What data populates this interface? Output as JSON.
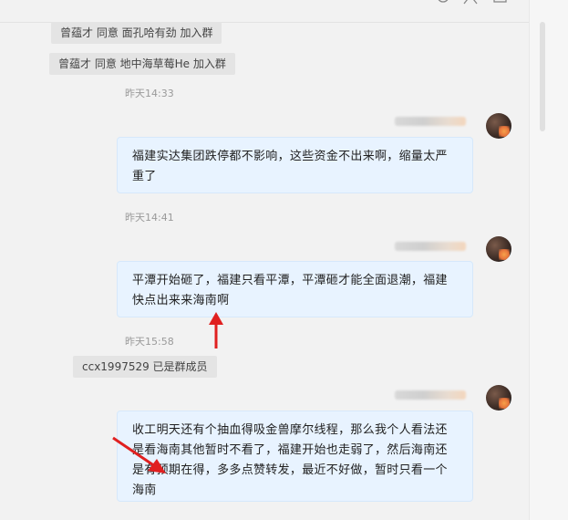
{
  "messages": [
    {
      "type": "system",
      "text": "曾蕴才 同意 面孔哈有劲 加入群"
    },
    {
      "type": "system",
      "text": "曾蕴才 同意 地中海草莓He 加入群"
    },
    {
      "type": "time",
      "text": "昨天14:33"
    },
    {
      "type": "chat",
      "text": "福建实达集团跌停都不影响，这些资金不出来啊，缩量太严重了"
    },
    {
      "type": "time",
      "text": "昨天14:41"
    },
    {
      "type": "chat",
      "text": "平潭开始砸了，福建只看平潭，平潭砸才能全面退潮，福建快点出来来海南啊"
    },
    {
      "type": "time",
      "text": "昨天15:58"
    },
    {
      "type": "system",
      "text": "ccx1997529 已是群成员"
    },
    {
      "type": "chat",
      "text": "收工明天还有个抽血得吸金兽摩尔线程，那么我个人看法还是看海南其他暂时不看了，福建开始也走弱了，然后海南还是有预期在得，多多点赞转发，最近不好做，暂时只看一个海南"
    }
  ],
  "colors": {
    "bubble": "#e8f3ff",
    "annotation_arrow": "#e02020"
  },
  "icons": [
    "settings-icon",
    "user-icon",
    "window-icon",
    "avatar"
  ]
}
